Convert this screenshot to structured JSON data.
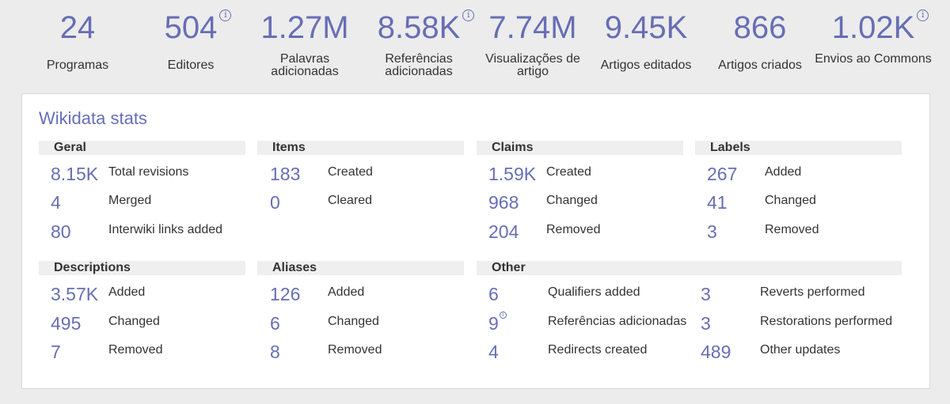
{
  "summary": [
    {
      "value": "24",
      "label": "Programas",
      "info": false
    },
    {
      "value": "504",
      "label": "Editores",
      "info": true
    },
    {
      "value": "1.27M",
      "label": "Palavras adicionadas",
      "info": false
    },
    {
      "value": "8.58K",
      "label": "Referências adicionadas",
      "info": true
    },
    {
      "value": "7.74M",
      "label": "Visualizações de artigo",
      "info": false
    },
    {
      "value": "9.45K",
      "label": "Artigos editados",
      "info": false
    },
    {
      "value": "866",
      "label": "Artigos criados",
      "info": false
    },
    {
      "value": "1.02K",
      "label": "Envios ao Commons",
      "info": true
    }
  ],
  "wikidata": {
    "title": "Wikidata stats",
    "geral": {
      "heading": "Geral",
      "rows": [
        {
          "value": "8.15K",
          "label": "Total revisions"
        },
        {
          "value": "4",
          "label": "Merged"
        },
        {
          "value": "80",
          "label": "Interwiki links added"
        }
      ]
    },
    "items": {
      "heading": "Items",
      "rows": [
        {
          "value": "183",
          "label": "Created"
        },
        {
          "value": "0",
          "label": "Cleared"
        }
      ]
    },
    "claims": {
      "heading": "Claims",
      "rows": [
        {
          "value": "1.59K",
          "label": "Created"
        },
        {
          "value": "968",
          "label": "Changed"
        },
        {
          "value": "204",
          "label": "Removed"
        }
      ]
    },
    "labels": {
      "heading": "Labels",
      "rows": [
        {
          "value": "267",
          "label": "Added"
        },
        {
          "value": "41",
          "label": "Changed"
        },
        {
          "value": "3",
          "label": "Removed"
        }
      ]
    },
    "descriptions": {
      "heading": "Descriptions",
      "rows": [
        {
          "value": "3.57K",
          "label": "Added"
        },
        {
          "value": "495",
          "label": "Changed"
        },
        {
          "value": "7",
          "label": "Removed"
        }
      ]
    },
    "aliases": {
      "heading": "Aliases",
      "rows": [
        {
          "value": "126",
          "label": "Added"
        },
        {
          "value": "6",
          "label": "Changed"
        },
        {
          "value": "8",
          "label": "Removed"
        }
      ]
    },
    "other": {
      "heading": "Other",
      "rows": [
        {
          "value": "6",
          "label": "Qualifiers added"
        },
        {
          "value": "9",
          "label": "Referências adicionadas"
        },
        {
          "value": "4",
          "label": "Redirects created"
        },
        {
          "value": "3",
          "label": "Reverts performed"
        },
        {
          "value": "3",
          "label": "Restorations performed"
        },
        {
          "value": "489",
          "label": "Other updates"
        }
      ]
    }
  },
  "colors": {
    "accent": "#676eb4",
    "background": "#ececec",
    "header_bg": "#efefef"
  },
  "icons": {
    "info": "info-circle-icon"
  }
}
